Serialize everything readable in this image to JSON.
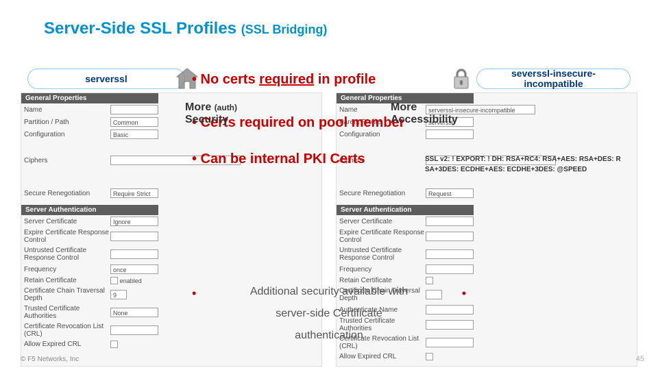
{
  "title_main": "Server-Side SSL Profiles ",
  "title_sub": "(SSL Bridging)",
  "left_pill": "serverssl",
  "right_pill": "severssl-insecure-incompatible",
  "bullets": {
    "b1_pre": "•  No certs ",
    "b1_u": "required",
    "b1_post": " in profile",
    "b2": "•  Certs required on pool member",
    "b3": "•  Can be internal PKI Certs"
  },
  "more_security_top": "More",
  "more_security_auth": "(auth)",
  "more_security_bottom": "Security",
  "more_access_top": "More",
  "more_access_bottom": "Accessibility",
  "cipher_string": "SSL v2: ! EXPORT: ! DH: RSA+RC4: RSA+AES: RSA+DES: RSA+3DES: ECDHE+AES: ECDHE+3DES: @SPEED",
  "center": {
    "l1": "Additional security available with",
    "l2": "server-side Certificate",
    "l3": "authentication"
  },
  "form_left": {
    "sec1": "General Properties",
    "name": "Name",
    "partition": "Partition / Path",
    "partition_v": "Common",
    "config": "Configuration",
    "config_v": "Basic",
    "ciphers": "Ciphers",
    "secure_reneg": "Secure Renegotiation",
    "secure_reneg_v": "Require Strict",
    "sec2": "Server Authentication",
    "server_cert": "Server Certificate",
    "server_cert_v": "Ignore",
    "expire_resp": "Expire Certificate Response Control",
    "untrusted_resp": "Untrusted Certificate Response Control",
    "frequency": "Frequency",
    "frequency_v": "once",
    "retain_cert": "Retain Certificate",
    "retain_cert_v": "enabled",
    "chain_depth": "Certificate Chain Traversal Depth",
    "chain_depth_v": "9",
    "trusted_ca": "Trusted Certificate Authorities",
    "trusted_ca_v": "None",
    "crl": "Certificate Revocation List (CRL)",
    "allow_expired": "Allow Expired CRL"
  },
  "form_right": {
    "sec1": "General Properties",
    "name": "Name",
    "name_v": "serverssl-insecure-incompatible",
    "parent": "Parent Profile",
    "parent_v": "serverssl",
    "config": "Configuration",
    "ciphers": "Ciphers",
    "secure_reneg": "Secure Renegotiation",
    "secure_reneg_v": "Request",
    "sec2": "Server Authentication",
    "server_cert": "Server Certificate",
    "expire_resp": "Expire Certificate Response Control",
    "untrusted_resp": "Untrusted Certificate Response Control",
    "frequency": "Frequency",
    "retain_cert": "Retain Certificate",
    "chain_depth": "Certificate Chain Traversal Depth",
    "auth_name": "Authenticate Name",
    "trusted_ca": "Trusted Certificate Authorities",
    "crl": "Certificate Revocation List (CRL)",
    "allow_expired": "Allow Expired CRL"
  },
  "footer_left": "© F5 Networks, Inc",
  "footer_right": "45"
}
